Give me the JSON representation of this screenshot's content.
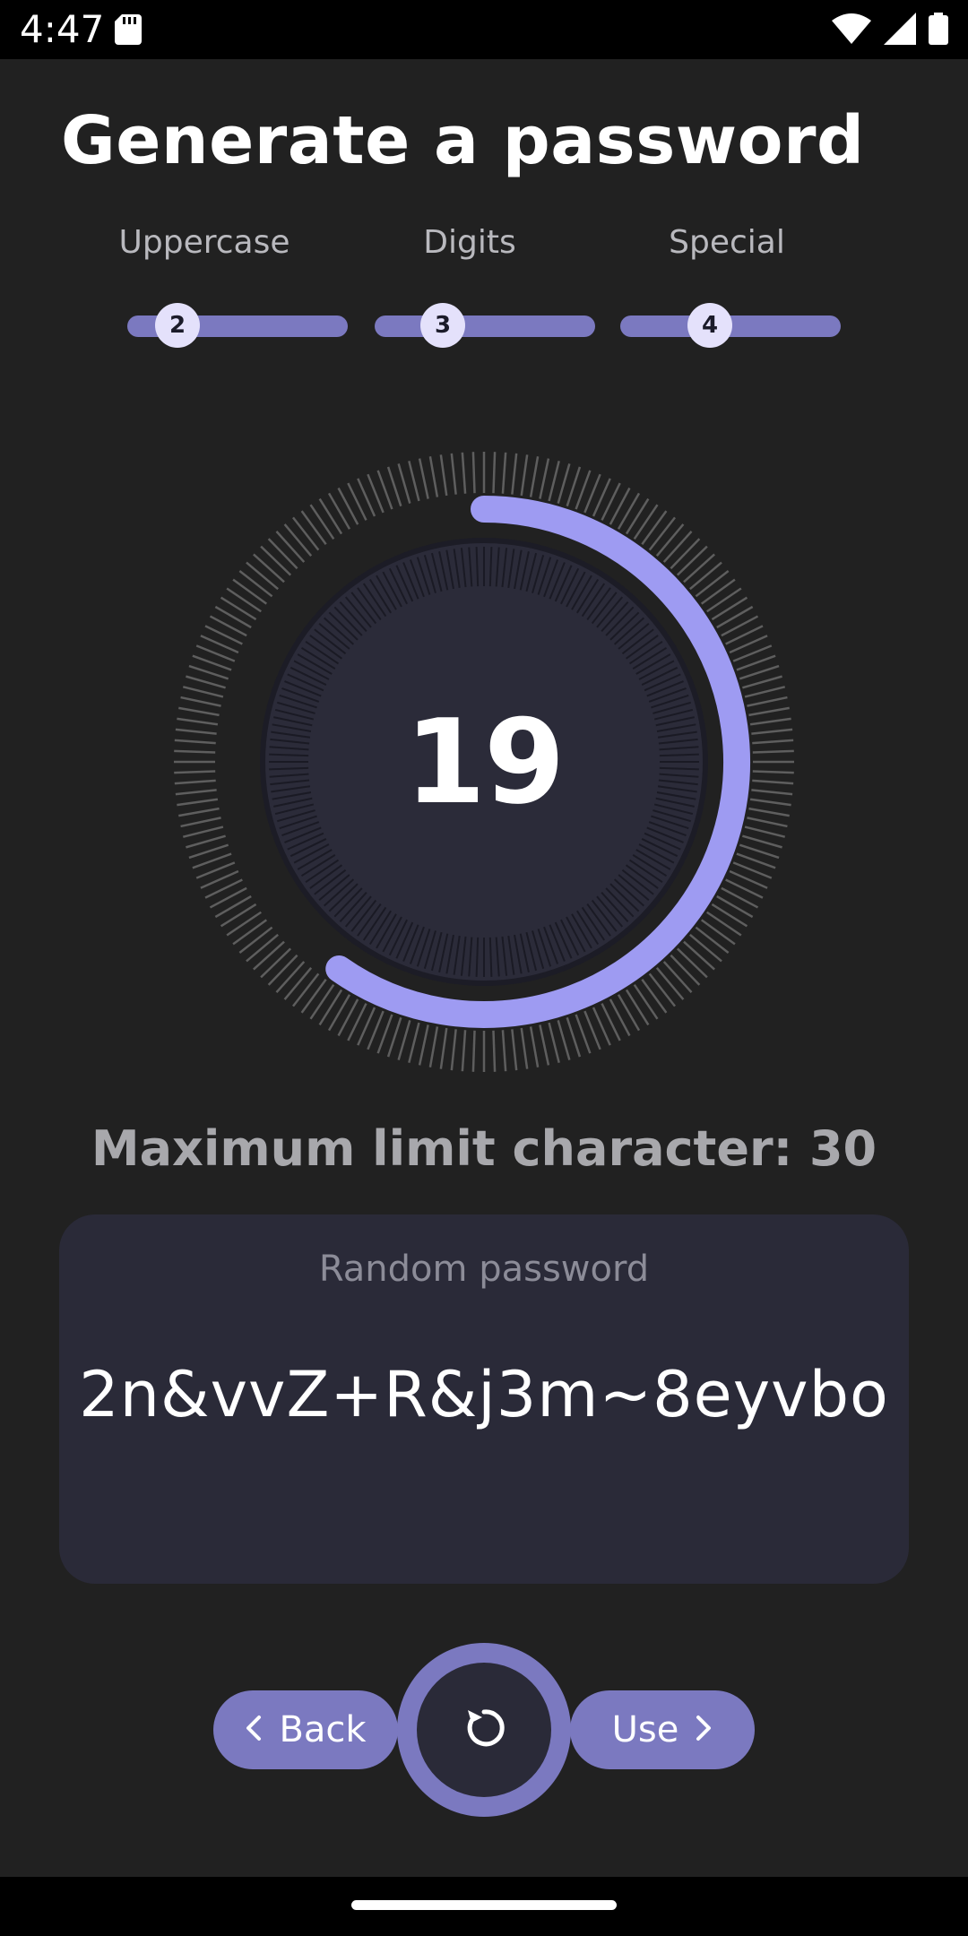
{
  "status_bar": {
    "time": "4:47",
    "icons": [
      "sd-card-icon",
      "wifi-icon",
      "cell-signal-icon",
      "battery-icon"
    ]
  },
  "title": "Generate a password",
  "sliders": [
    {
      "label": "Uppercase",
      "value": "2",
      "fraction": 0.22
    },
    {
      "label": "Digits",
      "value": "3",
      "fraction": 0.32
    },
    {
      "label": "Special",
      "value": "4",
      "fraction": 0.41
    }
  ],
  "dial": {
    "value": "19",
    "max": 30,
    "colors": {
      "accent": "#9e9bf2",
      "track_outer": "#5e5e5e",
      "center": "#2b2b39"
    }
  },
  "max_limit_text": "Maximum limit character: 30",
  "password_card": {
    "label": "Random password",
    "value": "2n&vvZ+R&j3m~8eyvbo"
  },
  "actions": {
    "back_label": "Back",
    "use_label": "Use",
    "refresh_icon": "refresh-icon"
  },
  "colors": {
    "background": "#212121",
    "accent": "#7b79c0",
    "card": "#2a2a38"
  }
}
